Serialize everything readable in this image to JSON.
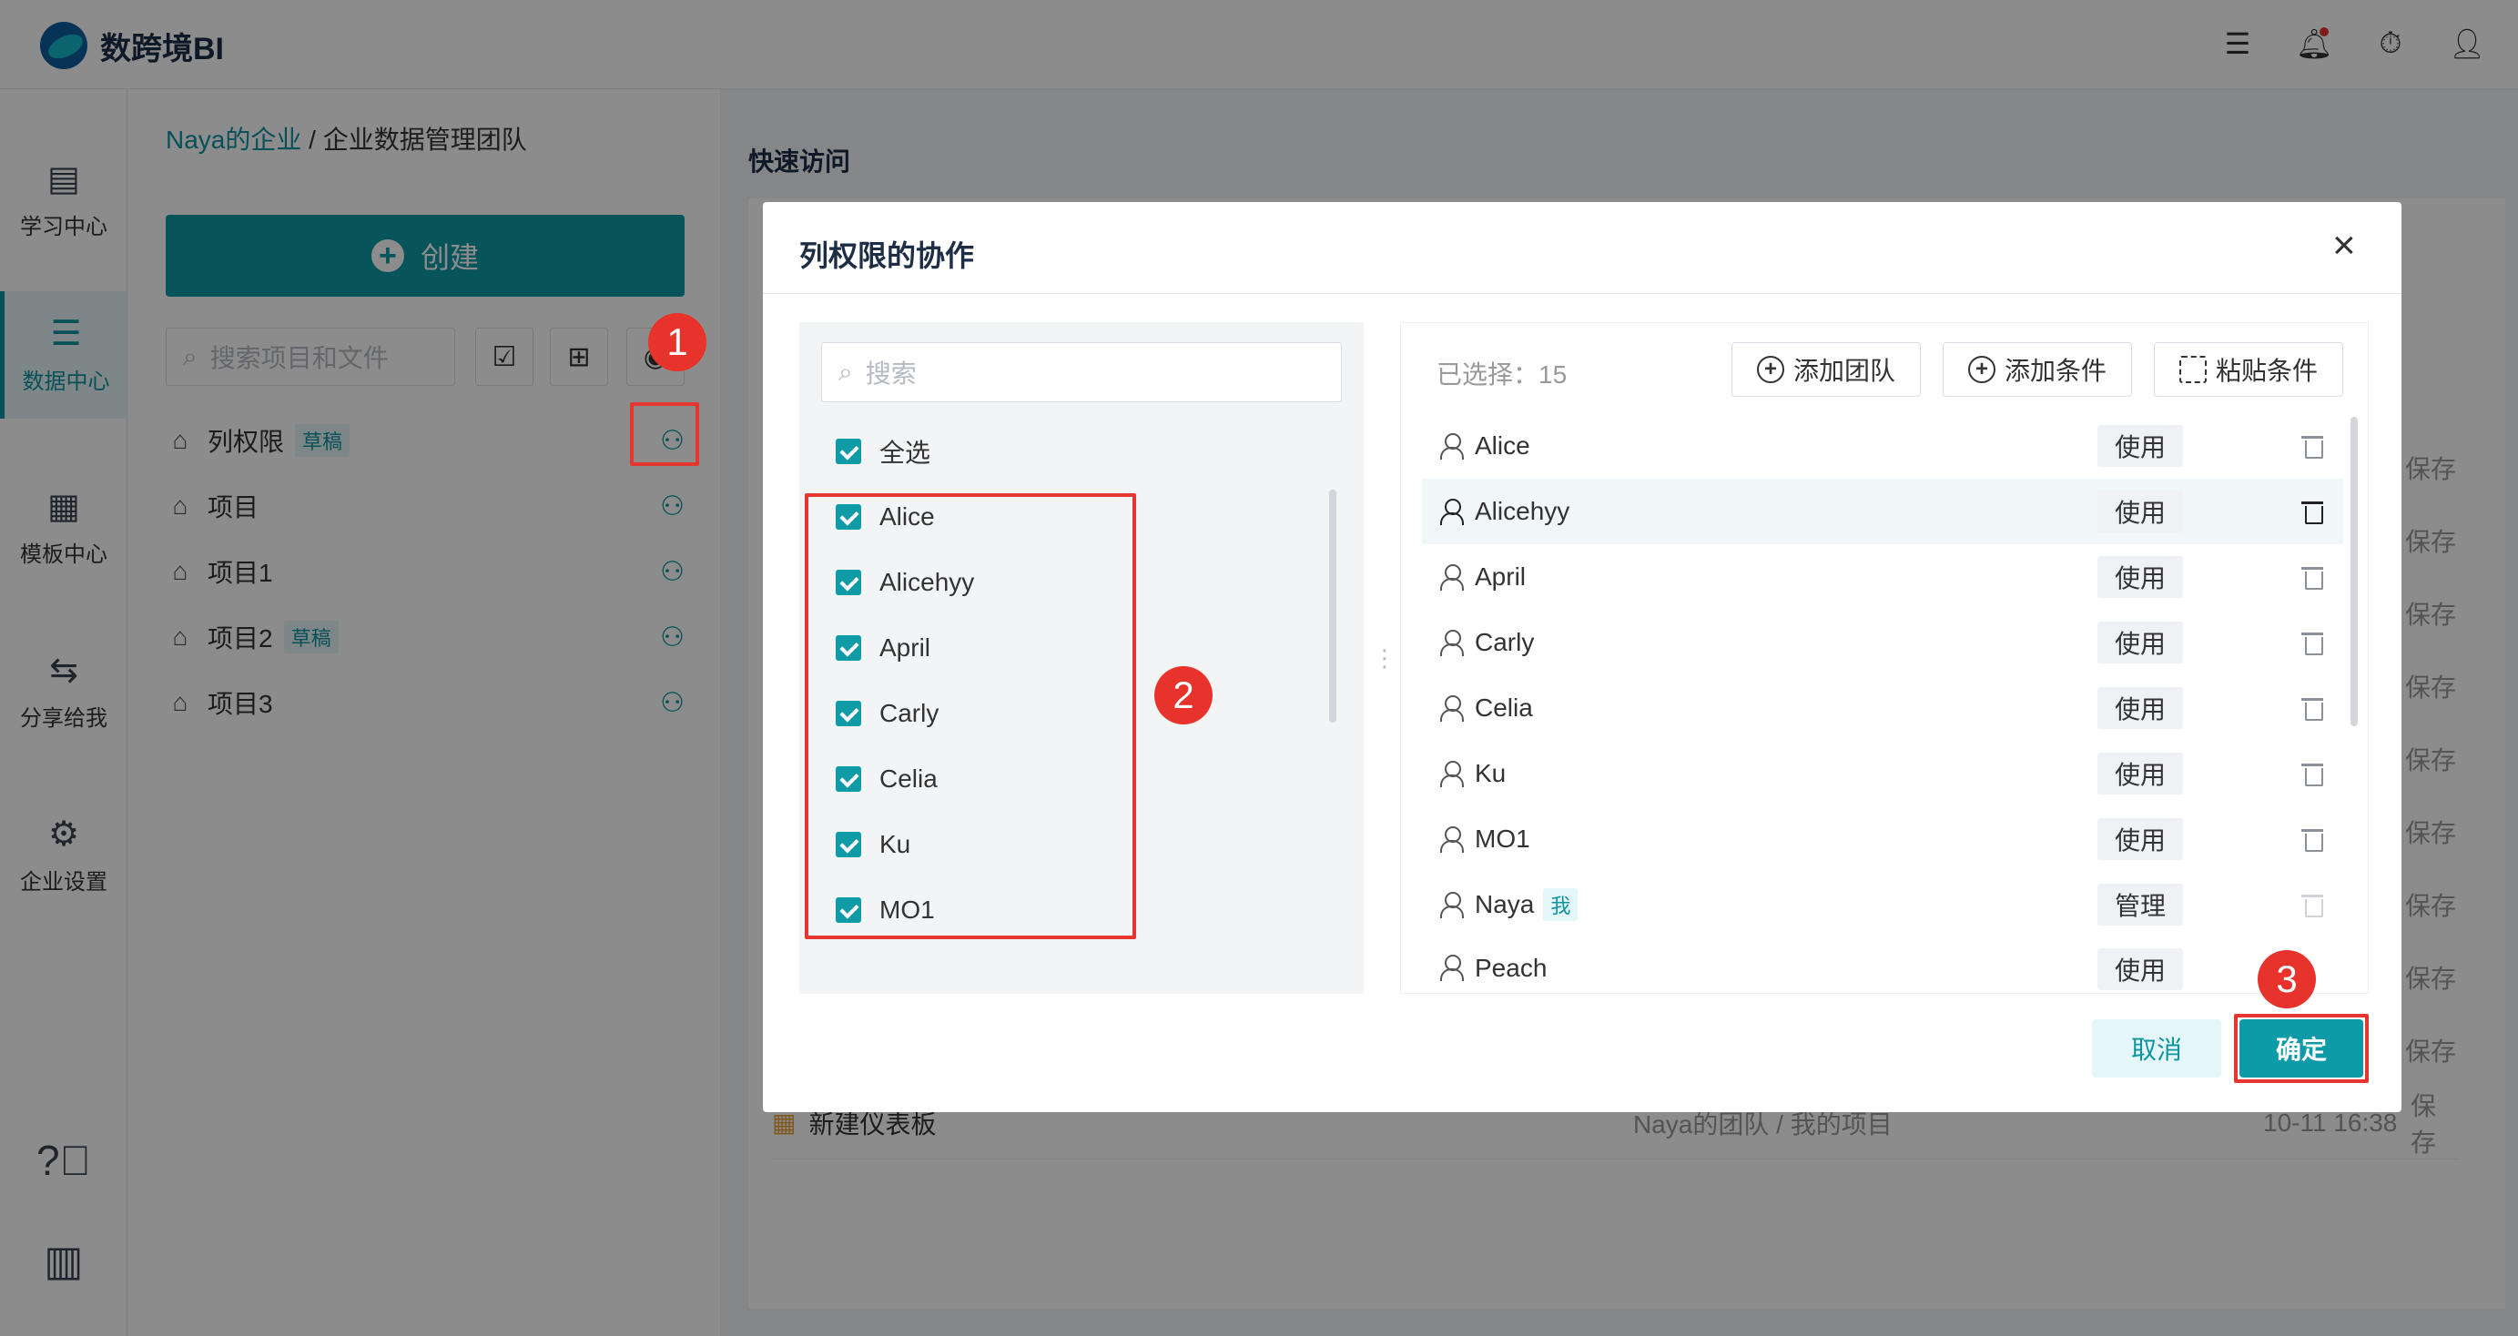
{
  "app": {
    "logo_text": "数跨境BI",
    "top_icons": [
      "list-icon",
      "bell-icon",
      "timer-icon",
      "user-icon"
    ]
  },
  "leftnav": {
    "items": [
      {
        "label": "学习中心",
        "icon": "book-icon",
        "active": false
      },
      {
        "label": "数据中心",
        "icon": "data-icon",
        "active": true
      },
      {
        "label": "模板中心",
        "icon": "template-icon",
        "active": false
      },
      {
        "label": "分享给我",
        "icon": "share-icon",
        "active": false
      },
      {
        "label": "企业设置",
        "icon": "gear-icon",
        "active": false
      }
    ],
    "bottom_icons": [
      "help-icon",
      "building-icon"
    ]
  },
  "projects": {
    "breadcrumb": {
      "org": "Naya的企业",
      "separator": "/",
      "team": "企业数据管理团队"
    },
    "create_label": "创建",
    "search_placeholder": "搜索项目和文件",
    "items": [
      {
        "name": "列权限",
        "badge": "草稿"
      },
      {
        "name": "项目",
        "badge": ""
      },
      {
        "name": "项目1",
        "badge": ""
      },
      {
        "name": "项目2",
        "badge": "草稿"
      },
      {
        "name": "项目3",
        "badge": ""
      }
    ]
  },
  "main": {
    "quick_access": "快速访问",
    "save_label": "保存",
    "last_row": {
      "name": "新建仪表板",
      "path": "Naya的团队 / 我的项目",
      "time": "10-11 16:38",
      "save": "保存"
    }
  },
  "modal": {
    "title": "列权限的协作",
    "search_placeholder": "搜索",
    "select_all": "全选",
    "left_members": [
      "Alice",
      "Alicehyy",
      "April",
      "Carly",
      "Celia",
      "Ku",
      "MO1"
    ],
    "selected_label": "已选择：15",
    "buttons": {
      "add_team": "添加团队",
      "add_condition": "添加条件",
      "paste_condition": "粘贴条件"
    },
    "members": [
      {
        "name": "Alice",
        "perm": "使用",
        "me": ""
      },
      {
        "name": "Alicehyy",
        "perm": "使用",
        "me": ""
      },
      {
        "name": "April",
        "perm": "使用",
        "me": ""
      },
      {
        "name": "Carly",
        "perm": "使用",
        "me": ""
      },
      {
        "name": "Celia",
        "perm": "使用",
        "me": ""
      },
      {
        "name": "Ku",
        "perm": "使用",
        "me": ""
      },
      {
        "name": "MO1",
        "perm": "使用",
        "me": ""
      },
      {
        "name": "Naya",
        "perm": "管理",
        "me": "我"
      },
      {
        "name": "Peach",
        "perm": "使用",
        "me": ""
      }
    ],
    "cancel": "取消",
    "confirm": "确定"
  },
  "annotations": {
    "step1": "1",
    "step2": "2",
    "step3": "3",
    "color": "#e5362f"
  }
}
